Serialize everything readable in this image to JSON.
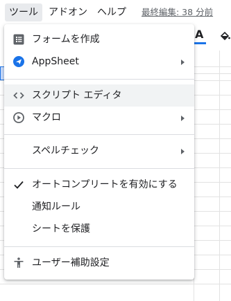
{
  "menubar": {
    "tools": "ツール",
    "addons": "アドオン",
    "help": "ヘルプ",
    "last_edit": "最終編集: 38 分前"
  },
  "toolbar": {
    "text_color_glyph": "A"
  },
  "tools_menu": {
    "items": [
      {
        "label": "フォームを作成",
        "icon": "form-icon",
        "submenu": false
      },
      {
        "label": "AppSheet",
        "icon": "appsheet-icon",
        "submenu": true
      },
      {
        "label": "スクリプト エディタ",
        "icon": "code-icon",
        "submenu": false,
        "highlighted": true
      },
      {
        "label": "マクロ",
        "icon": "play-circle-icon",
        "submenu": true
      },
      {
        "label": "スペルチェック",
        "icon": "",
        "submenu": true
      },
      {
        "label": "オートコンプリートを有効にする",
        "icon": "check-icon",
        "submenu": false,
        "checked": true
      },
      {
        "label": "通知ルール",
        "icon": "",
        "submenu": false
      },
      {
        "label": "シートを保護",
        "icon": "",
        "submenu": false
      },
      {
        "label": "ユーザー補助設定",
        "icon": "accessibility-icon",
        "submenu": false
      }
    ]
  },
  "colors": {
    "accent": "#1a73e8",
    "hover": "#f1f3f4",
    "menu_active": "#e8eaed",
    "appsheet": "#1a73e8"
  }
}
